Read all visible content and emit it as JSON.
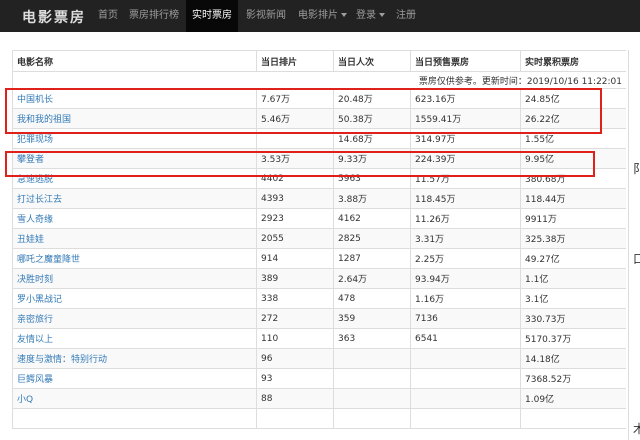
{
  "navbar": {
    "brand": "电影票房",
    "items": [
      {
        "label": "首页",
        "active": false
      },
      {
        "label": "票房排行榜",
        "active": false
      },
      {
        "label": "实时票房",
        "active": true
      },
      {
        "label": "影视新闻",
        "active": false
      },
      {
        "label": "电影排片",
        "active": false,
        "dropdown": true
      },
      {
        "label": "登录",
        "active": false,
        "dropdown": true
      },
      {
        "label": "注册",
        "active": false
      }
    ]
  },
  "table": {
    "headers": [
      "电影名称",
      "当日排片",
      "当日人次",
      "当日预售票房",
      "实时累积票房"
    ],
    "note": "票房仅供参考。更新时间：2019/10/16 11:22:01",
    "rows": [
      [
        "中国机长",
        "7.67万",
        "20.48万",
        "623.16万",
        "24.85亿"
      ],
      [
        "我和我的祖国",
        "5.46万",
        "50.38万",
        "1559.41万",
        "26.22亿"
      ],
      [
        "犯罪现场",
        "",
        "14.68万",
        "314.97万",
        "1.55亿"
      ],
      [
        "攀登者",
        "3.53万",
        "9.33万",
        "224.39万",
        "9.95亿"
      ],
      [
        "急速逃脱",
        "4402",
        "5963",
        "11.57万",
        "380.68万"
      ],
      [
        "打过长江去",
        "4393",
        "3.88万",
        "118.45万",
        "118.44万"
      ],
      [
        "雪人奇缘",
        "2923",
        "4162",
        "11.26万",
        "9911万"
      ],
      [
        "丑娃娃",
        "2055",
        "2825",
        "3.31万",
        "325.38万"
      ],
      [
        "哪吒之魔童降世",
        "914",
        "1287",
        "2.25万",
        "49.27亿"
      ],
      [
        "决胜时刻",
        "389",
        "2.64万",
        "93.94万",
        "1.1亿"
      ],
      [
        "罗小黑战记",
        "338",
        "478",
        "1.16万",
        "3.1亿"
      ],
      [
        "亲密旅行",
        "272",
        "359",
        "7136",
        "330.73万"
      ],
      [
        "友情以上",
        "110",
        "363",
        "6541",
        "5170.37万"
      ],
      [
        "速度与激情：特别行动",
        "96",
        "",
        "",
        "14.18亿"
      ],
      [
        "巨鳄风暴",
        "93",
        "",
        "",
        "7368.52万"
      ],
      [
        "小Q",
        "88",
        "",
        "",
        "1.09亿"
      ],
      [
        "",
        "",
        "",
        "",
        ""
      ]
    ]
  },
  "side_chars": [
    "阝",
    "口",
    "木"
  ],
  "colors": {
    "navbar_bg": "#222222",
    "active_bg": "#080808",
    "link": "#337ab7",
    "highlight": "#e0201a"
  }
}
